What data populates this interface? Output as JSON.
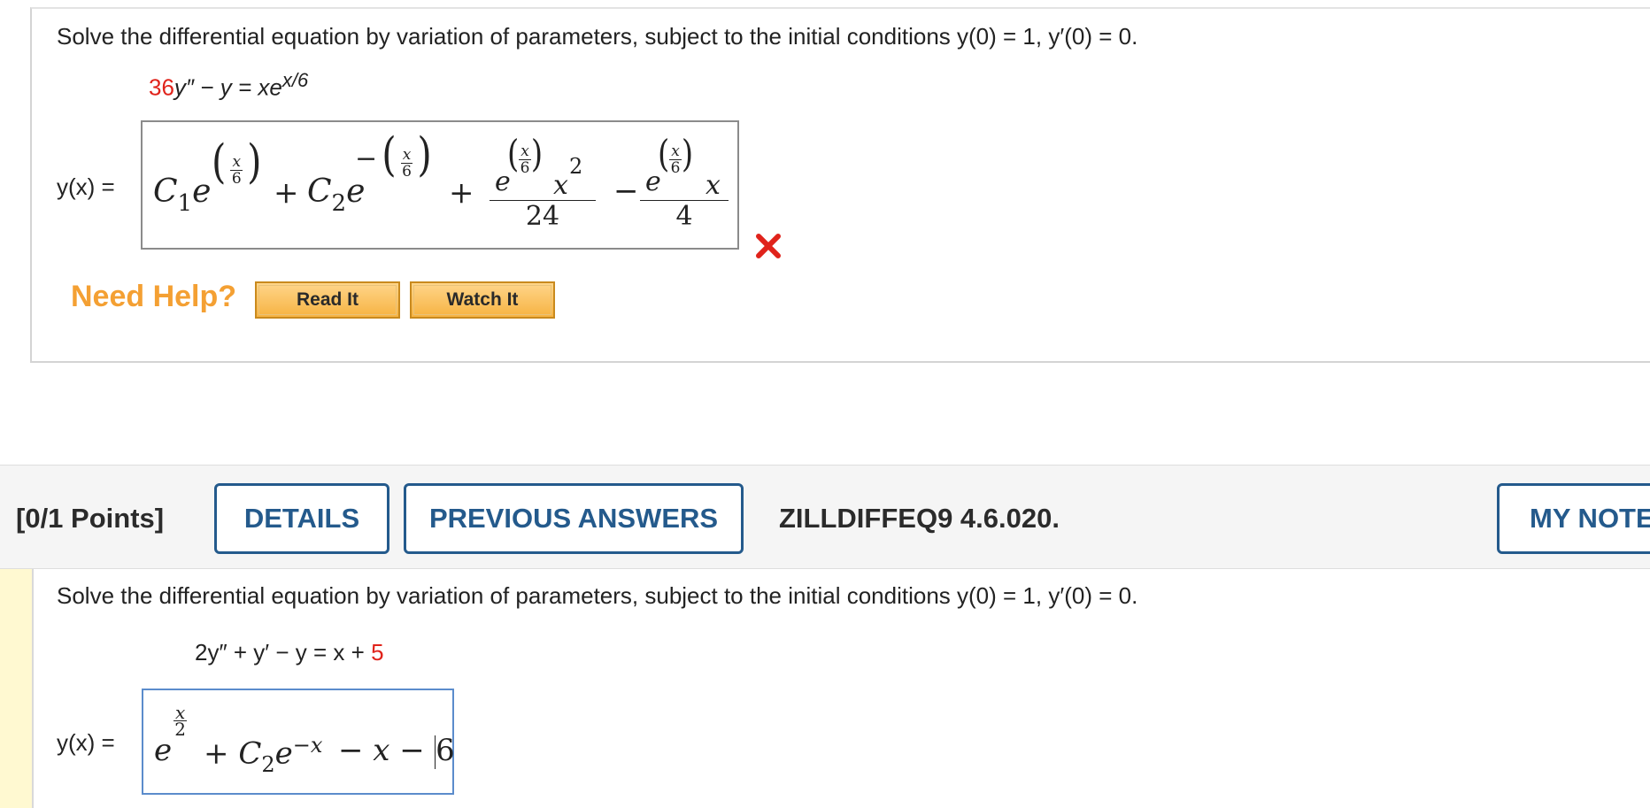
{
  "question1": {
    "prompt": "Solve the differential equation by variation of parameters, subject to the initial conditions y(0) = 1, y′(0) = 0.",
    "equation": {
      "coefficient": "36",
      "rest": "y″ − y = xe",
      "exponent": "x/6"
    },
    "answer_label": "y(x) =",
    "answer": {
      "c1": "C",
      "c1_sub": "1",
      "c2": "C",
      "c2_sub": "2",
      "e": "e",
      "x_num": "x",
      "six_den": "6",
      "minus": "−",
      "plus": "+",
      "x_sq": "x",
      "sq": "2",
      "den1": "24",
      "x_lin": "x",
      "den2": "4"
    },
    "status": "incorrect",
    "status_color": "#e0231b",
    "need_help": "Need Help?",
    "read_it": "Read It",
    "watch_it": "Watch It"
  },
  "question2_header": {
    "points": "[0/1 Points]",
    "details": "DETAILS",
    "previous_answers": "PREVIOUS ANSWERS",
    "code": "ZILLDIFFEQ9 4.6.020.",
    "my_notes": "MY NOTES"
  },
  "question2": {
    "prompt": "Solve the differential equation by variation of parameters, subject to the initial conditions y(0) = 1, y′(0) = 0.",
    "equation": {
      "left": "2y″ + y′ − y = x + ",
      "constant": "5"
    },
    "answer_label": "y(x) =",
    "answer": {
      "e": "e",
      "exp_num": "x",
      "exp_den": "2",
      "plus": "+",
      "c2": "C",
      "c2_sub": "2",
      "e2": "e",
      "exp2": "−x",
      "tail": "− x −",
      "last": "6"
    }
  },
  "colors": {
    "accent_blue": "#245a8c",
    "help_orange": "#f4a033",
    "error_red": "#e0231b",
    "left_highlight": "#fff9d1"
  }
}
